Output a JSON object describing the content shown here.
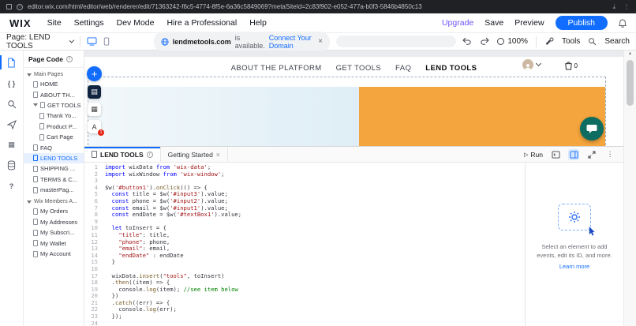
{
  "browser": {
    "url": "editor.wix.com/html/editor/web/renderer/edit/71363242-f6c5-4774-8f5e-6a36c5849069?metaSiteId=2c83f902-e052-477a-b0f3-5846b4850c13"
  },
  "menubar": {
    "logo": "WIX",
    "items": [
      "Site",
      "Settings",
      "Dev Mode",
      "Hire a Professional",
      "Help"
    ],
    "upgrade": "Upgrade",
    "save": "Save",
    "preview": "Preview",
    "publish": "Publish"
  },
  "toolbar": {
    "page_label": "Page: LEND TOOLS",
    "domain": "lendmetools.com",
    "domain_suffix": " is available.",
    "domain_link": "Connect Your Domain",
    "zoom": "100%",
    "tools": "Tools",
    "search": "Search"
  },
  "pages_panel": {
    "title": "Page Code",
    "sections": [
      {
        "label": "Main Pages",
        "items": [
          {
            "label": "HOME"
          },
          {
            "label": "ABOUT TH..."
          },
          {
            "label": "GET TOOLS",
            "expanded": true
          },
          {
            "label": "Thank Yo...",
            "indent": 1
          },
          {
            "label": "Product P...",
            "indent": 1
          },
          {
            "label": "Cart Page",
            "indent": 1
          },
          {
            "label": "FAQ"
          },
          {
            "label": "LEND TOOLS",
            "selected": true
          },
          {
            "label": "SHIPPING ..."
          },
          {
            "label": "TERMS & C..."
          },
          {
            "label": "masterPag..."
          }
        ]
      },
      {
        "label": "Wix Members A...",
        "items": [
          {
            "label": "My Orders"
          },
          {
            "label": "My Addresses"
          },
          {
            "label": "My Subscri..."
          },
          {
            "label": "My Wallet"
          },
          {
            "label": "My Account"
          }
        ]
      }
    ]
  },
  "canvas": {
    "nav": [
      "ABOUT THE PLATFORM",
      "GET TOOLS",
      "FAQ",
      "LEND TOOLS"
    ],
    "current_nav": "LEND TOOLS",
    "cart_count": "0",
    "toolbar_badge": "1"
  },
  "code_panel": {
    "tab_active": "LEND TOOLS",
    "tab_secondary": "Getting Started",
    "run": "Run",
    "lines": [
      [
        [
          "kw",
          "import"
        ],
        [
          "pl",
          " wixData "
        ],
        [
          "kw",
          "from"
        ],
        [
          "pl",
          " "
        ],
        [
          "str",
          "'wix-data'"
        ],
        [
          "pl",
          ";"
        ]
      ],
      [
        [
          "kw",
          "import"
        ],
        [
          "pl",
          " wixWindow "
        ],
        [
          "kw",
          "from"
        ],
        [
          "pl",
          " "
        ],
        [
          "str",
          "'wix-window'"
        ],
        [
          "pl",
          ";"
        ]
      ],
      [],
      [
        [
          "pl",
          "$w("
        ],
        [
          "str",
          "'#button1'"
        ],
        [
          "pl",
          ")."
        ],
        [
          "fn",
          "onClick"
        ],
        [
          "pl",
          "(() => {"
        ]
      ],
      [
        [
          "pl",
          "  "
        ],
        [
          "kw",
          "const"
        ],
        [
          "pl",
          " title = $w("
        ],
        [
          "str",
          "'#input3'"
        ],
        [
          "pl",
          ").value;"
        ]
      ],
      [
        [
          "pl",
          "  "
        ],
        [
          "kw",
          "const"
        ],
        [
          "pl",
          " phone = $w("
        ],
        [
          "str",
          "'#input2'"
        ],
        [
          "pl",
          ").value;"
        ]
      ],
      [
        [
          "pl",
          "  "
        ],
        [
          "kw",
          "const"
        ],
        [
          "pl",
          " email = $w("
        ],
        [
          "str",
          "'#input1'"
        ],
        [
          "pl",
          ").value;"
        ]
      ],
      [
        [
          "pl",
          "  "
        ],
        [
          "kw",
          "const"
        ],
        [
          "pl",
          " endDate = $w("
        ],
        [
          "str",
          "'#textBox1'"
        ],
        [
          "pl",
          ").value;"
        ]
      ],
      [],
      [
        [
          "pl",
          "  "
        ],
        [
          "kw",
          "let"
        ],
        [
          "pl",
          " toInsert = {"
        ]
      ],
      [
        [
          "pl",
          "    "
        ],
        [
          "str",
          "\"title\""
        ],
        [
          "pl",
          ": title,"
        ]
      ],
      [
        [
          "pl",
          "    "
        ],
        [
          "str",
          "\"phone\""
        ],
        [
          "pl",
          ": phone,"
        ]
      ],
      [
        [
          "pl",
          "    "
        ],
        [
          "str",
          "\"email\""
        ],
        [
          "pl",
          ": email,"
        ]
      ],
      [
        [
          "pl",
          "    "
        ],
        [
          "str",
          "\"endDate\""
        ],
        [
          "pl",
          " : endDate"
        ]
      ],
      [
        [
          "pl",
          "  }"
        ]
      ],
      [],
      [
        [
          "pl",
          "  wixData."
        ],
        [
          "fn",
          "insert"
        ],
        [
          "pl",
          "("
        ],
        [
          "str",
          "\"tools\""
        ],
        [
          "pl",
          ", toInsert)"
        ]
      ],
      [
        [
          "pl",
          "  ."
        ],
        [
          "fn",
          "then"
        ],
        [
          "pl",
          "((item) => {"
        ]
      ],
      [
        [
          "pl",
          "    console."
        ],
        [
          "fn",
          "log"
        ],
        [
          "pl",
          "(item); "
        ],
        [
          "cmt",
          "//see item below"
        ]
      ],
      [
        [
          "pl",
          "  })"
        ]
      ],
      [
        [
          "pl",
          "  ."
        ],
        [
          "fn",
          "catch"
        ],
        [
          "pl",
          "((err) => {"
        ]
      ],
      [
        [
          "pl",
          "    console."
        ],
        [
          "fn",
          "log"
        ],
        [
          "pl",
          "(err);"
        ]
      ],
      [
        [
          "pl",
          "  });"
        ]
      ],
      []
    ],
    "properties": {
      "message": "Select an element to add events, edit its ID, and more.",
      "link": "Learn more"
    }
  },
  "icons": {
    "plus": "+",
    "braces": "{ }",
    "grid": "▦",
    "section": "▤",
    "help": "?",
    "close": "×",
    "play": "▷",
    "info": "i",
    "text_button": "A",
    "scroll_up": "▲",
    "dots": "⋮"
  },
  "colors": {
    "accent": "#116dff",
    "hero_orange": "#f5a53d",
    "chat": "#0e6d60"
  }
}
